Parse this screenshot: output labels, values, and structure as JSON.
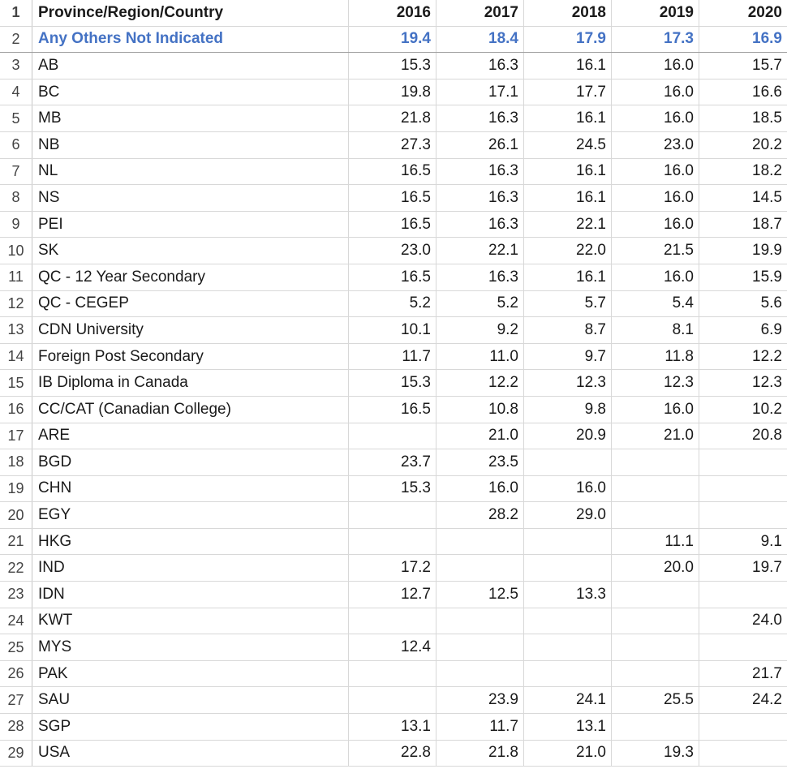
{
  "columns": [
    "Province/Region/Country",
    "2016",
    "2017",
    "2018",
    "2019",
    "2020"
  ],
  "rows": [
    {
      "num": "1",
      "label": "Province/Region/Country",
      "values": [
        "2016",
        "2017",
        "2018",
        "2019",
        "2020"
      ]
    },
    {
      "num": "2",
      "label": "Any Others Not Indicated",
      "values": [
        "19.4",
        "18.4",
        "17.9",
        "17.3",
        "16.9"
      ]
    },
    {
      "num": "3",
      "label": "AB",
      "values": [
        "15.3",
        "16.3",
        "16.1",
        "16.0",
        "15.7"
      ]
    },
    {
      "num": "4",
      "label": "BC",
      "values": [
        "19.8",
        "17.1",
        "17.7",
        "16.0",
        "16.6"
      ]
    },
    {
      "num": "5",
      "label": "MB",
      "values": [
        "21.8",
        "16.3",
        "16.1",
        "16.0",
        "18.5"
      ]
    },
    {
      "num": "6",
      "label": "NB",
      "values": [
        "27.3",
        "26.1",
        "24.5",
        "23.0",
        "20.2"
      ]
    },
    {
      "num": "7",
      "label": "NL",
      "values": [
        "16.5",
        "16.3",
        "16.1",
        "16.0",
        "18.2"
      ]
    },
    {
      "num": "8",
      "label": "NS",
      "values": [
        "16.5",
        "16.3",
        "16.1",
        "16.0",
        "14.5"
      ]
    },
    {
      "num": "9",
      "label": "PEI",
      "values": [
        "16.5",
        "16.3",
        "22.1",
        "16.0",
        "18.7"
      ]
    },
    {
      "num": "10",
      "label": "SK",
      "values": [
        "23.0",
        "22.1",
        "22.0",
        "21.5",
        "19.9"
      ]
    },
    {
      "num": "11",
      "label": "QC - 12 Year Secondary",
      "values": [
        "16.5",
        "16.3",
        "16.1",
        "16.0",
        "15.9"
      ]
    },
    {
      "num": "12",
      "label": "QC - CEGEP",
      "values": [
        "5.2",
        "5.2",
        "5.7",
        "5.4",
        "5.6"
      ]
    },
    {
      "num": "13",
      "label": "CDN University",
      "values": [
        "10.1",
        "9.2",
        "8.7",
        "8.1",
        "6.9"
      ]
    },
    {
      "num": "14",
      "label": "Foreign Post Secondary",
      "values": [
        "11.7",
        "11.0",
        "9.7",
        "11.8",
        "12.2"
      ]
    },
    {
      "num": "15",
      "label": "IB Diploma in Canada",
      "values": [
        "15.3",
        "12.2",
        "12.3",
        "12.3",
        "12.3"
      ]
    },
    {
      "num": "16",
      "label": "CC/CAT (Canadian College)",
      "values": [
        "16.5",
        "10.8",
        "9.8",
        "16.0",
        "10.2"
      ]
    },
    {
      "num": "17",
      "label": "ARE",
      "values": [
        "",
        "21.0",
        "20.9",
        "21.0",
        "20.8"
      ]
    },
    {
      "num": "18",
      "label": "BGD",
      "values": [
        "23.7",
        "23.5",
        "",
        "",
        ""
      ]
    },
    {
      "num": "19",
      "label": "CHN",
      "values": [
        "15.3",
        "16.0",
        "16.0",
        "",
        ""
      ]
    },
    {
      "num": "20",
      "label": "EGY",
      "values": [
        "",
        "28.2",
        "29.0",
        "",
        ""
      ]
    },
    {
      "num": "21",
      "label": "HKG",
      "values": [
        "",
        "",
        "",
        "11.1",
        "9.1"
      ]
    },
    {
      "num": "22",
      "label": "IND",
      "values": [
        "17.2",
        "",
        "",
        "20.0",
        "19.7"
      ]
    },
    {
      "num": "23",
      "label": "IDN",
      "values": [
        "12.7",
        "12.5",
        "13.3",
        "",
        ""
      ]
    },
    {
      "num": "24",
      "label": "KWT",
      "values": [
        "",
        "",
        "",
        "",
        "24.0"
      ]
    },
    {
      "num": "25",
      "label": "MYS",
      "values": [
        "12.4",
        "",
        "",
        "",
        ""
      ]
    },
    {
      "num": "26",
      "label": "PAK",
      "values": [
        "",
        "",
        "",
        "",
        "21.7"
      ]
    },
    {
      "num": "27",
      "label": "SAU",
      "values": [
        "",
        "23.9",
        "24.1",
        "25.5",
        "24.2"
      ]
    },
    {
      "num": "28",
      "label": "SGP",
      "values": [
        "13.1",
        "11.7",
        "13.1",
        "",
        ""
      ]
    },
    {
      "num": "29",
      "label": "USA",
      "values": [
        "22.8",
        "21.8",
        "21.0",
        "19.3",
        ""
      ]
    }
  ],
  "colors": {
    "highlight": "#4472c4",
    "grid": "#d8d8d8"
  }
}
